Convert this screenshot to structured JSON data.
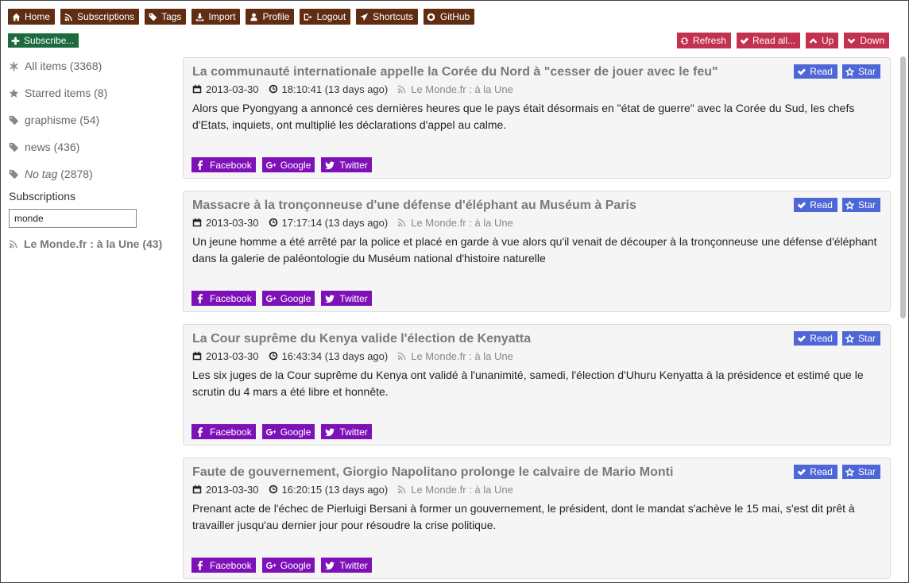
{
  "nav": [
    {
      "label": "Home",
      "icon": "home-icon"
    },
    {
      "label": "Subscriptions",
      "icon": "rss-icon"
    },
    {
      "label": "Tags",
      "icon": "tags-icon"
    },
    {
      "label": "Import",
      "icon": "download-icon"
    },
    {
      "label": "Profile",
      "icon": "user-icon"
    },
    {
      "label": "Logout",
      "icon": "logout-icon"
    },
    {
      "label": "Shortcuts",
      "icon": "plane-icon"
    },
    {
      "label": "GitHub",
      "icon": "github-icon"
    }
  ],
  "subscribe_label": "Subscribe...",
  "actions": {
    "refresh": "Refresh",
    "read_all": "Read all...",
    "up": "Up",
    "down": "Down"
  },
  "sidebar": {
    "all_items": {
      "label": "All items",
      "count": "(3368)"
    },
    "starred": {
      "label": "Starred items",
      "count": "(8)"
    },
    "tags": [
      {
        "label": "graphisme",
        "count": "(54)"
      },
      {
        "label": "news",
        "count": "(436)"
      }
    ],
    "no_tag": {
      "label": "No tag",
      "count": "(2878)"
    },
    "subscriptions_heading": "Subscriptions",
    "search_value": "monde",
    "feed": "Le Monde.fr : à la Une (43)"
  },
  "article_buttons": {
    "read": "Read",
    "star": "Star"
  },
  "share": {
    "facebook": "Facebook",
    "google": "Google",
    "twitter": "Twitter"
  },
  "articles": [
    {
      "title": "La communauté internationale appelle la Corée du Nord à \"cesser de jouer avec le feu\"",
      "date": "2013-03-30",
      "time": "18:10:41 (13 days ago)",
      "source": "Le Monde.fr : à la Une",
      "body": "Alors que Pyongyang a annoncé ces dernières heures que le pays était désormais en \"état de guerre\" avec la Corée du Sud, les chefs d'Etats, inquiets, ont multiplié les déclarations d'appel au calme."
    },
    {
      "title": "Massacre à la tronçonneuse d'une défense d'éléphant au Muséum à Paris",
      "date": "2013-03-30",
      "time": "17:17:14 (13 days ago)",
      "source": "Le Monde.fr : à la Une",
      "body": "Un jeune homme a été arrêté par la police et placé en garde à vue alors qu'il venait de découper à la tronçonneuse une défense d'éléphant dans la galerie de paléontologie du Muséum national d'histoire naturelle"
    },
    {
      "title": "La Cour suprême du Kenya valide l'élection de Kenyatta",
      "date": "2013-03-30",
      "time": "16:43:34 (13 days ago)",
      "source": "Le Monde.fr : à la Une",
      "body": "Les six juges de la Cour suprême du Kenya ont validé à l'unanimité, samedi, l'élection d'Uhuru Kenyatta à la présidence et estimé que le scrutin du 4 mars a été libre et honnête."
    },
    {
      "title": "Faute de gouvernement, Giorgio Napolitano prolonge le calvaire de Mario Monti",
      "date": "2013-03-30",
      "time": "16:20:15 (13 days ago)",
      "source": "Le Monde.fr : à la Une",
      "body": "Prenant acte de l'échec de Pierluigi Bersani à former un gouvernement, le président, dont le mandat s'achève le 15 mai, s'est dit prêt à travailler jusqu'au dernier jour pour résoudre la crise politique."
    }
  ],
  "colors": {
    "nav_bg": "#612d12",
    "subscribe_bg": "#1c6b3f",
    "action_bg": "#c2314f",
    "article_btn_bg": "#4e67d6",
    "share_bg": "#7e10b8"
  }
}
